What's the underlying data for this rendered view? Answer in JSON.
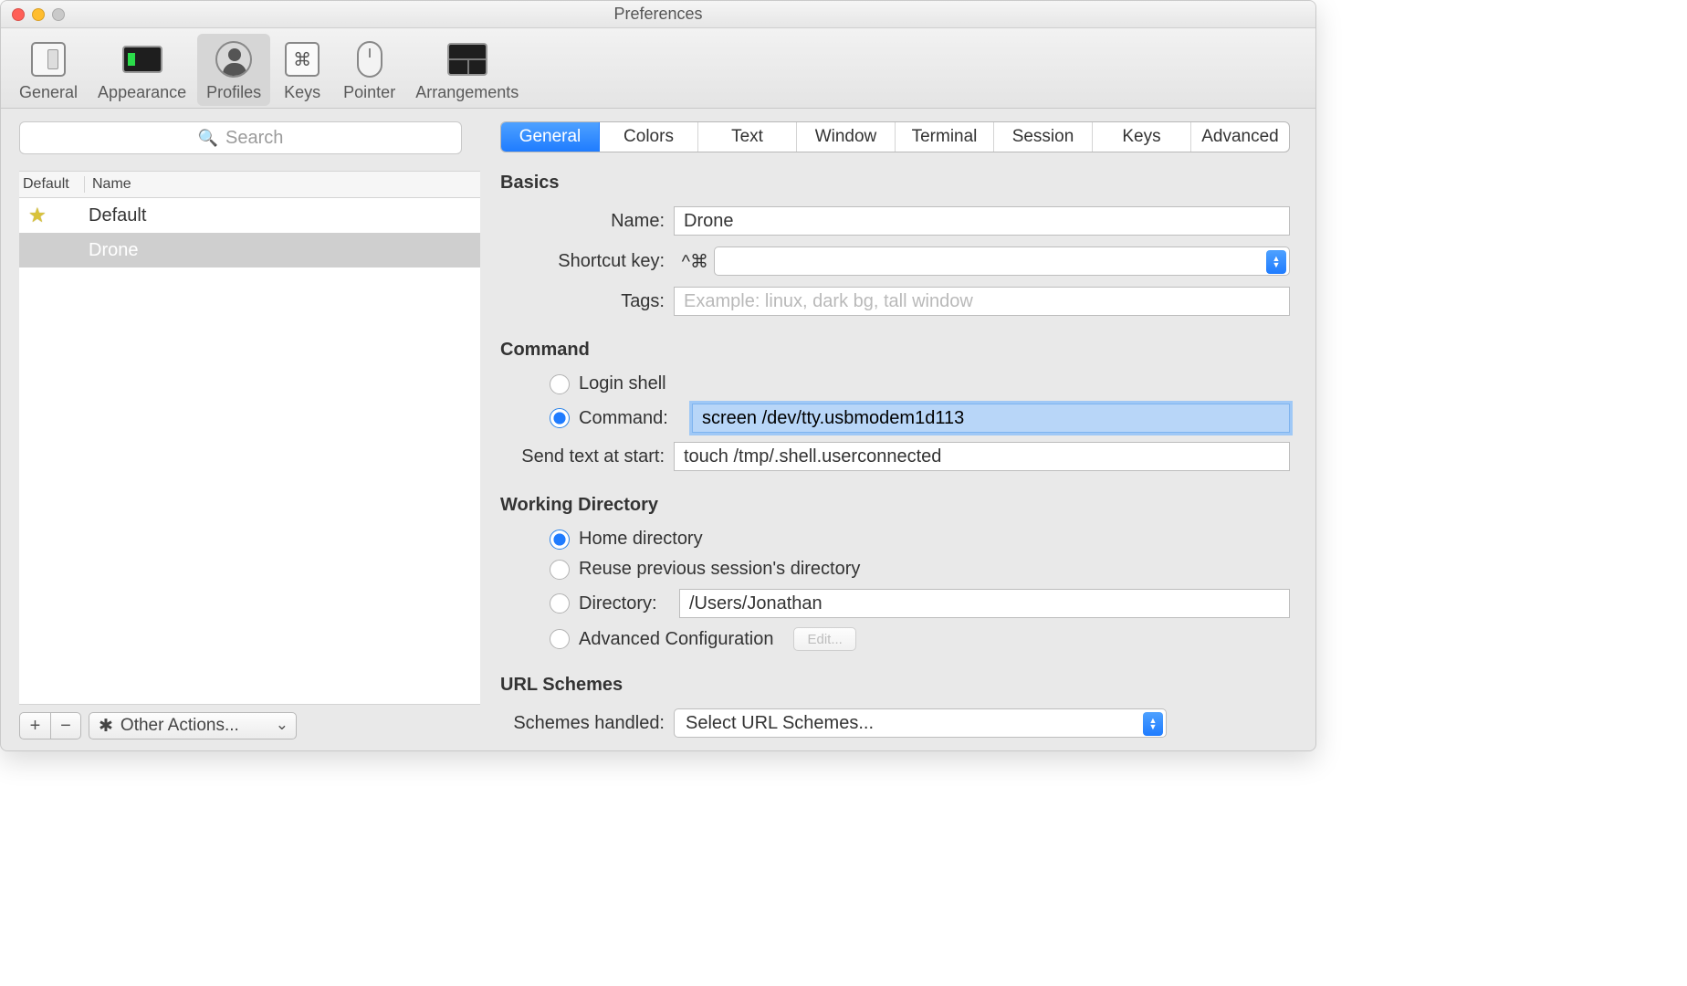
{
  "window": {
    "title": "Preferences"
  },
  "toolbar": {
    "items": [
      {
        "label": "General"
      },
      {
        "label": "Appearance"
      },
      {
        "label": "Profiles"
      },
      {
        "label": "Keys"
      },
      {
        "label": "Pointer"
      },
      {
        "label": "Arrangements"
      }
    ],
    "selected_index": 2
  },
  "sidebar": {
    "search_placeholder": "Search",
    "columns": {
      "default": "Default",
      "name": "Name"
    },
    "profiles": [
      {
        "name": "Default",
        "is_default": true
      },
      {
        "name": "Drone",
        "is_default": false
      }
    ],
    "selected_index": 1,
    "footer": {
      "add": "+",
      "remove": "−",
      "other_actions": "Other Actions..."
    }
  },
  "tabs": [
    "General",
    "Colors",
    "Text",
    "Window",
    "Terminal",
    "Session",
    "Keys",
    "Advanced"
  ],
  "active_tab_index": 0,
  "sections": {
    "basics": {
      "title": "Basics",
      "name_label": "Name:",
      "name_value": "Drone",
      "shortcut_label": "Shortcut key:",
      "shortcut_prefix": "^⌘",
      "shortcut_value": "",
      "tags_label": "Tags:",
      "tags_placeholder": "Example: linux, dark bg, tall window",
      "tags_value": ""
    },
    "command": {
      "title": "Command",
      "login_shell_label": "Login shell",
      "command_label": "Command:",
      "command_value": "screen /dev/tty.usbmodem1d113",
      "send_text_label": "Send text at start:",
      "send_text_value": "touch /tmp/.shell.userconnected",
      "selected_radio": "command"
    },
    "workdir": {
      "title": "Working Directory",
      "home_label": "Home directory",
      "reuse_label": "Reuse previous session's directory",
      "directory_label": "Directory:",
      "directory_value": "/Users/Jonathan",
      "advanced_label": "Advanced Configuration",
      "edit_label": "Edit...",
      "selected_radio": "home"
    },
    "url": {
      "title": "URL Schemes",
      "schemes_label": "Schemes handled:",
      "schemes_value": "Select URL Schemes..."
    }
  }
}
